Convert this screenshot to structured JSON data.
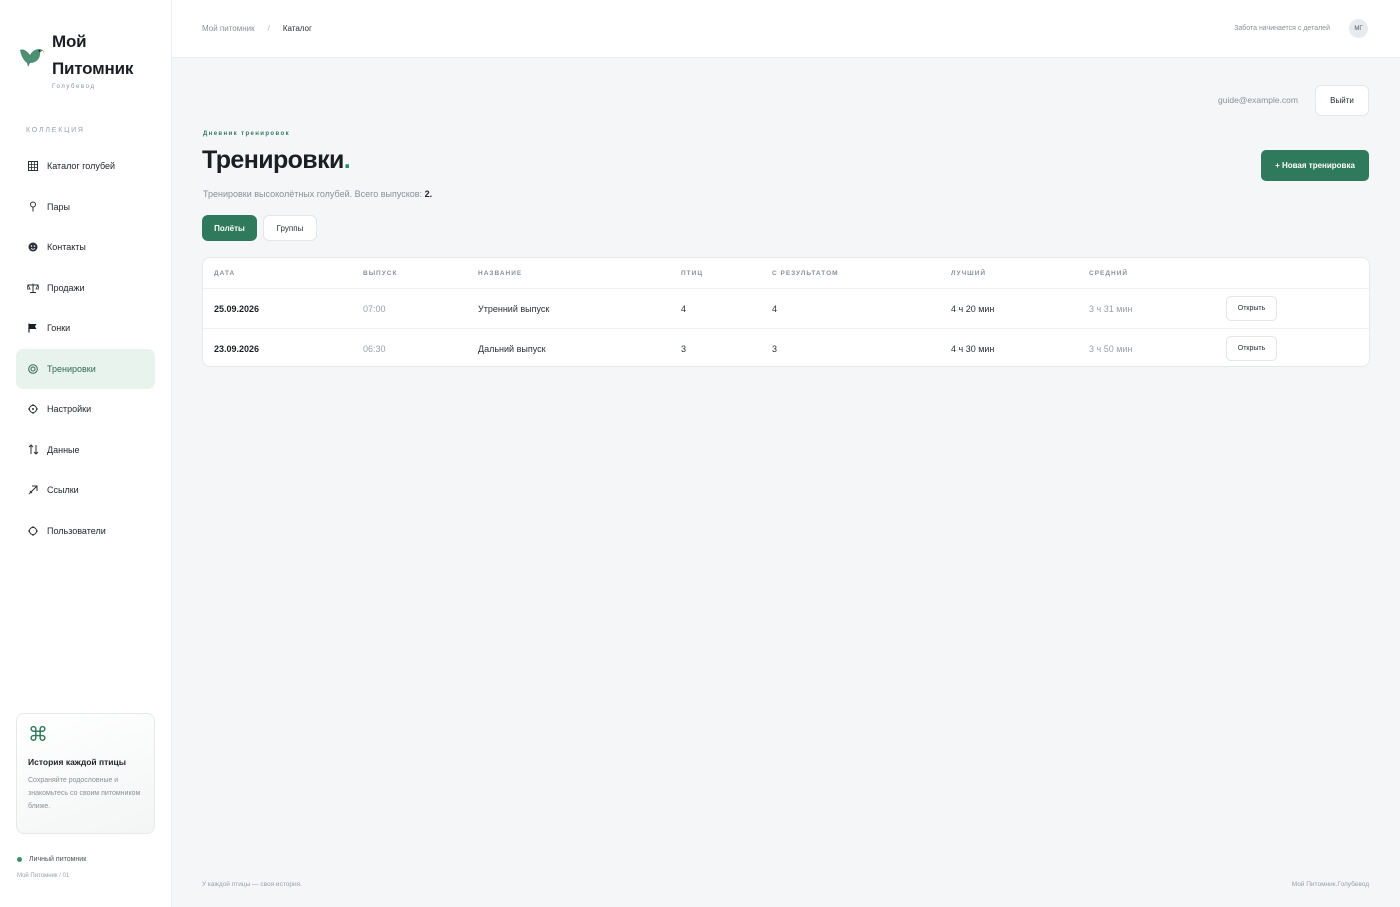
{
  "brand": {
    "name_line1": "Мой",
    "name_line2": "Питомник",
    "subtitle": "Голубевод"
  },
  "sidebar": {
    "section_label": "КОЛЛЕКЦИЯ",
    "items": [
      {
        "label": "Каталог голубей",
        "icon": "grid-icon"
      },
      {
        "label": "Пары",
        "icon": "pin-icon"
      },
      {
        "label": "Контакты",
        "icon": "contacts-icon"
      },
      {
        "label": "Продажи",
        "icon": "scales-icon"
      },
      {
        "label": "Гонки",
        "icon": "flag-icon"
      },
      {
        "label": "Тренировки",
        "icon": "target-icon",
        "active": true
      },
      {
        "label": "Настройки",
        "icon": "gear-icon"
      },
      {
        "label": "Данные",
        "icon": "sort-arrows-icon"
      },
      {
        "label": "Ссылки",
        "icon": "link-arrow-icon"
      },
      {
        "label": "Пользователи",
        "icon": "users-icon"
      }
    ],
    "promo": {
      "title": "История каждой птицы",
      "text": "Сохраняйте родословные и знакомьтесь со своим питомником ближе."
    },
    "status": "Личный питомник",
    "version": "Мой Питомник / 01"
  },
  "topbar": {
    "breadcrumb": [
      "Мой питомник",
      "Каталог"
    ],
    "breadcrumb_sep": "/",
    "tagline": "Забота начинается с деталей",
    "avatar": "МГ"
  },
  "account": {
    "email": "guide@example.com",
    "logout_label": "Выйти"
  },
  "page": {
    "eyebrow": "Дневник тренировок",
    "title": "Тренировки",
    "title_accent": ".",
    "subtitle": "Тренировки высоколётных голубей. Всего выпусков:",
    "total": "2.",
    "new_button": "+ Новая тренировка",
    "tabs": [
      {
        "label": "Полёты",
        "active": true
      },
      {
        "label": "Группы",
        "active": false
      }
    ]
  },
  "table": {
    "columns": [
      "ДАТА",
      "ВЫПУСК",
      "НАЗВАНИЕ",
      "ПТИЦ",
      "С РЕЗУЛЬТАТОМ",
      "ЛУЧШИЙ",
      "СРЕДНИЙ"
    ],
    "rows": [
      {
        "date": "25.09.2026",
        "release": "07:00",
        "name": "Утренний выпуск",
        "birds": "4",
        "with_result": "4",
        "best": "4 ч 20 мин",
        "avg": "3 ч 31 мин",
        "action": "Открыть"
      },
      {
        "date": "23.09.2026",
        "release": "06:30",
        "name": "Дальний выпуск",
        "birds": "3",
        "with_result": "3",
        "best": "4 ч 30 мин",
        "avg": "3 ч 50 мин",
        "action": "Открыть"
      }
    ]
  },
  "footer": {
    "left": "У каждой птицы — своя история.",
    "right": "Мой Питомник.Голубевод"
  },
  "colors": {
    "accent": "#2f7a5c",
    "active_bg": "#e9f3ee",
    "background": "#f5f6f8"
  }
}
